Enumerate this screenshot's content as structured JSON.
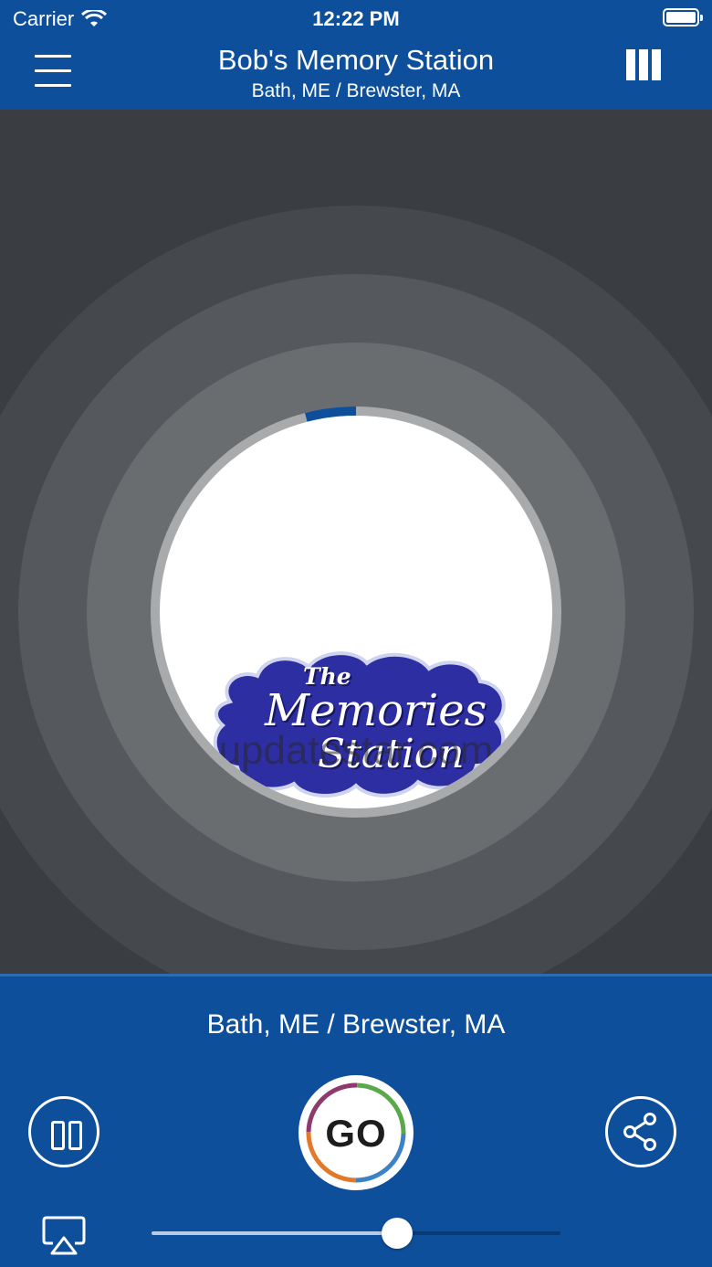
{
  "status_bar": {
    "carrier": "Carrier",
    "time": "12:22 PM"
  },
  "header": {
    "title": "Bob's Memory Station",
    "subtitle": "Bath, ME / Brewster, MA"
  },
  "icons": {
    "menu": "hamburger-icon",
    "stations": "bars-icon",
    "pause": "pause-icon",
    "share": "share-icon",
    "airplay": "airplay-icon",
    "wifi": "wifi-icon",
    "battery": "battery-icon"
  },
  "logo": {
    "line1": "The",
    "line2": "Memories",
    "line3": "Station"
  },
  "watermark": "updatestar.com",
  "player": {
    "location": "Bath, ME / Brewster, MA",
    "go_label": "GO",
    "progress": 0.04,
    "volume": 0.6
  },
  "colors": {
    "brand": "#0e4f9c",
    "progress": "#0e4f9c",
    "background": "#3a3d42"
  }
}
